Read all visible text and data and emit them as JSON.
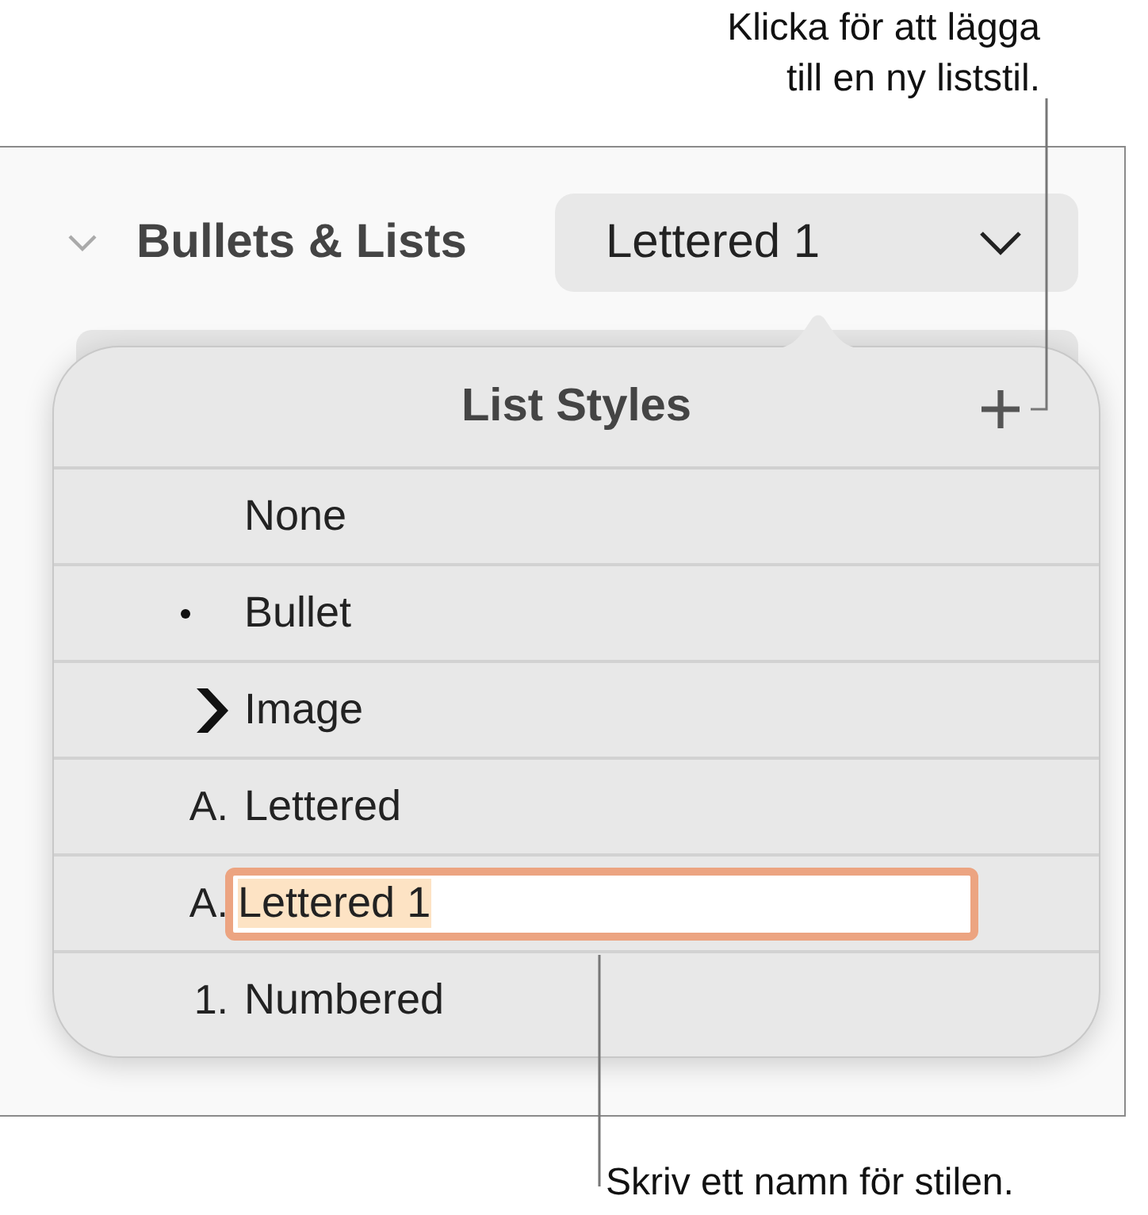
{
  "callouts": [
    {
      "kind": "top",
      "text": "Klicka för att lägga\ntill en ny liststil."
    },
    {
      "kind": "bottom",
      "text": "Skriv ett namn för stilen."
    }
  ],
  "inspector": {
    "section": {
      "title": "Bullets & Lists",
      "expanded": true
    },
    "style_popup": {
      "value": "Lettered 1"
    }
  },
  "popover": {
    "title": "List Styles",
    "items": [
      {
        "kind": "none",
        "label": "None",
        "editing": false
      },
      {
        "kind": "bullet",
        "label": "Bullet",
        "editing": false
      },
      {
        "kind": "image",
        "label": "Image",
        "editing": false
      },
      {
        "kind": "text",
        "marker": "A.",
        "label": "Lettered",
        "editing": false
      },
      {
        "kind": "text",
        "marker": "A.",
        "label": "Lettered 1",
        "editing": true
      },
      {
        "kind": "text",
        "marker": "1.",
        "label": "Numbered",
        "editing": false
      }
    ]
  }
}
